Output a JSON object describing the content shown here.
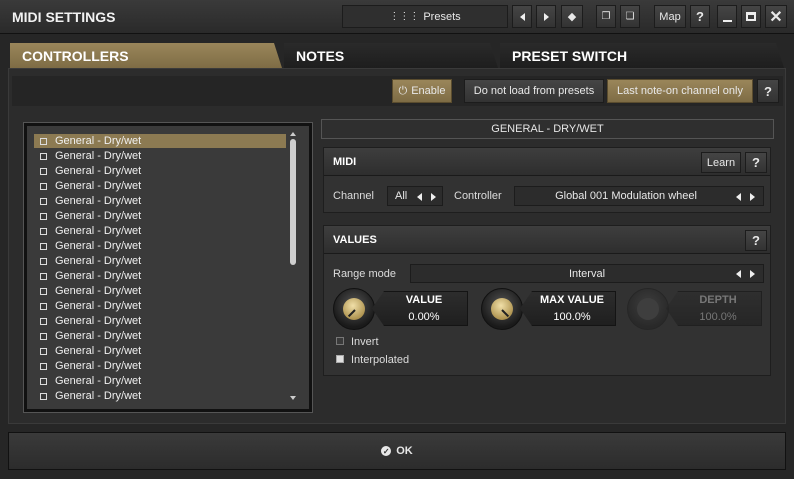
{
  "title": "MIDI SETTINGS",
  "topbar": {
    "presets": "Presets",
    "map": "Map",
    "help": "?"
  },
  "tabs": [
    {
      "label": "CONTROLLERS"
    },
    {
      "label": "NOTES"
    },
    {
      "label": "PRESET SWITCH"
    }
  ],
  "toolbar": {
    "enable": "Enable",
    "no_load": "Do not load from presets",
    "last_note": "Last note-on channel only",
    "help": "?"
  },
  "list": {
    "items": [
      "General - Dry/wet",
      "General - Dry/wet",
      "General - Dry/wet",
      "General - Dry/wet",
      "General - Dry/wet",
      "General - Dry/wet",
      "General - Dry/wet",
      "General - Dry/wet",
      "General - Dry/wet",
      "General - Dry/wet",
      "General - Dry/wet",
      "General - Dry/wet",
      "General - Dry/wet",
      "General - Dry/wet",
      "General - Dry/wet",
      "General - Dry/wet",
      "General - Dry/wet",
      "General - Dry/wet"
    ]
  },
  "selected_title": "GENERAL - DRY/WET",
  "midi": {
    "header": "MIDI",
    "learn": "Learn",
    "help": "?",
    "channel_label": "Channel",
    "channel_value": "All",
    "controller_label": "Controller",
    "controller_value": "Global 001 Modulation wheel"
  },
  "values": {
    "header": "VALUES",
    "help": "?",
    "range_label": "Range mode",
    "range_value": "Interval",
    "value_label": "VALUE",
    "value": "0.00%",
    "max_label": "MAX VALUE",
    "max_value": "100.0%",
    "depth_label": "DEPTH",
    "depth_value": "100.0%",
    "invert": "Invert",
    "interpolated": "Interpolated"
  },
  "ok": "OK",
  "colors": {
    "accent": "#8c7a52",
    "bg": "#262626"
  }
}
